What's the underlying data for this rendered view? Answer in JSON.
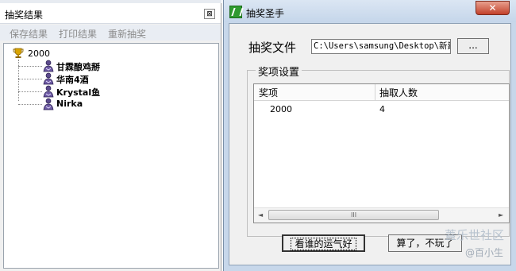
{
  "results_window": {
    "title": "抽奖结果",
    "close_glyph": "⊠",
    "toolbar": [
      "保存结果",
      "打印结果",
      "重新抽奖"
    ],
    "tree": {
      "root": "2000",
      "children": [
        "甘霖酿鸡掰",
        "华南4酒",
        "Krystal鱼",
        "Nirka"
      ]
    }
  },
  "main_window": {
    "title": "抽奖圣手",
    "close_glyph": "✕",
    "file_label": "抽奖文件",
    "file_path": "C:\\Users\\samsung\\Desktop\\新建",
    "browse_label": "...",
    "group_title": "奖项设置",
    "table": {
      "columns": [
        "奖项",
        "抽取人数"
      ],
      "rows": [
        [
          "2000",
          "4"
        ]
      ]
    },
    "scrollbar": {
      "left": "◄",
      "right": "►",
      "grip": "III"
    },
    "lucky_button": "看谁的运气好",
    "quit_button": "算了，不玩了"
  },
  "watermark": {
    "line1": "蓋乐世社区",
    "line2": "@百小生"
  }
}
